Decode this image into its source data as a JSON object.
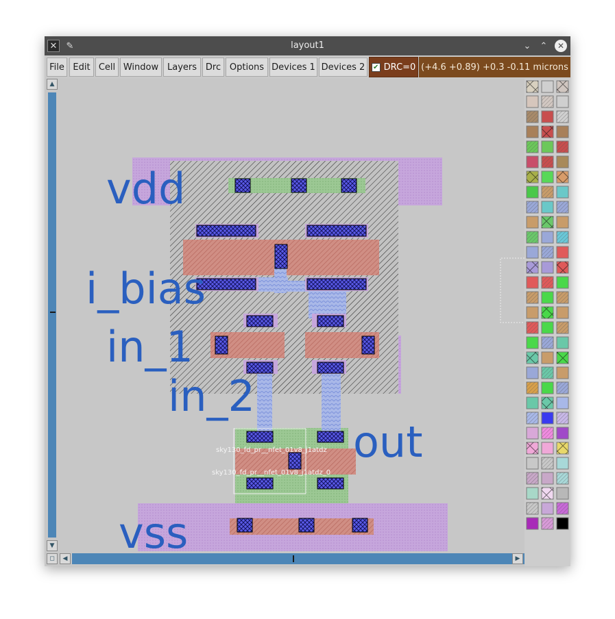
{
  "window": {
    "title": "layout1"
  },
  "menu": {
    "items": [
      "File",
      "Edit",
      "Cell",
      "Window",
      "Layers",
      "Drc",
      "Options",
      "Devices 1",
      "Devices 2"
    ],
    "drc_label": "DRC=0",
    "drc_checked": true,
    "coords": "(+4.6 +0.89) +0.3 -0.11 microns"
  },
  "labels": {
    "vdd": "vdd",
    "i_bias": "i_bias",
    "in_1": "in_1",
    "in_2": "in_2",
    "out": "out",
    "vss": "vss"
  },
  "instances": {
    "a": "sky130_fd_pr__nfet_01v8_j1atdz",
    "b": "sky130_fd_pr__nfet_01v8_j1atdz_0"
  },
  "colors": {
    "label_text": "#2a5fbf",
    "canvas_bg": "#c7c7c7",
    "menu_drc_bg": "#7a3d1c",
    "coords_bg": "#7b4a1e",
    "scrollbar": "#4d86b7"
  },
  "palette": {
    "icons": [
      "layer-swatch-grid-icon"
    ]
  }
}
